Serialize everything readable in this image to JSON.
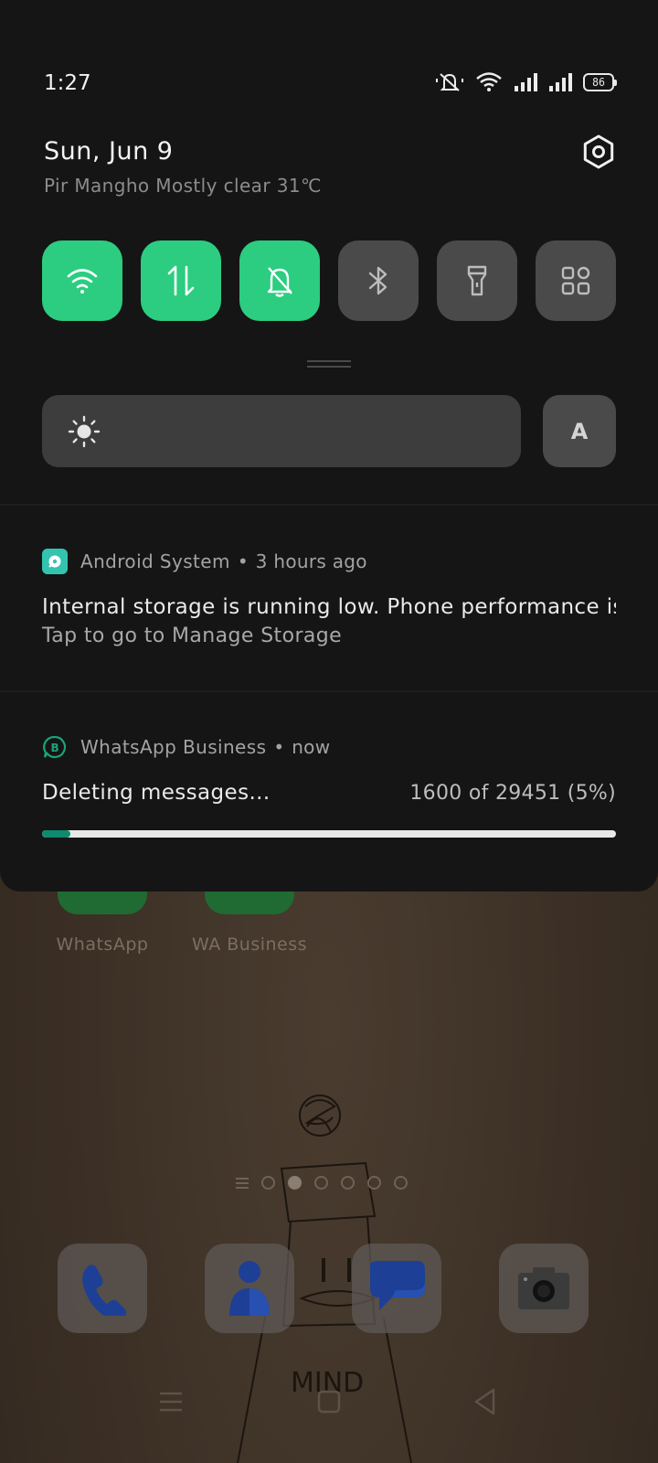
{
  "status_bar": {
    "time": "1:27",
    "battery_level": "86",
    "icons": [
      "mute-icon",
      "wifi-icon",
      "signal-icon",
      "signal-icon",
      "battery-icon"
    ]
  },
  "header": {
    "date": "Sun, Jun 9",
    "weather": "Pir Mangho Mostly clear 31℃"
  },
  "quick_settings": {
    "tiles": [
      {
        "icon": "wifi-icon",
        "state": "on"
      },
      {
        "icon": "mobile-data-icon",
        "state": "on"
      },
      {
        "icon": "silent-mode-icon",
        "state": "on"
      },
      {
        "icon": "bluetooth-icon",
        "state": "off"
      },
      {
        "icon": "flashlight-icon",
        "state": "off"
      },
      {
        "icon": "apps-grid-icon",
        "state": "off"
      }
    ],
    "auto_brightness_label": "A",
    "accent_color": "#2ccd80"
  },
  "notifications": [
    {
      "app": "Android System",
      "time": "3 hours ago",
      "title": "Internal storage is running low. Phone performance is..",
      "subtitle": "Tap to go to Manage Storage",
      "icon_color": "#33c4b0"
    },
    {
      "app": "WhatsApp Business",
      "time": "now",
      "title": "Deleting messages...",
      "progress_text": "1600 of 29451 (5%)",
      "progress_fraction": 0.05,
      "icon_color": "#1aa37a"
    }
  ],
  "home_screen": {
    "apps": [
      "WhatsApp",
      "WA Business"
    ],
    "page_count": 6,
    "active_page": 1,
    "wallpaper_text": "MIND",
    "dock": [
      "phone-icon",
      "contacts-icon",
      "messages-icon",
      "camera-icon"
    ]
  }
}
